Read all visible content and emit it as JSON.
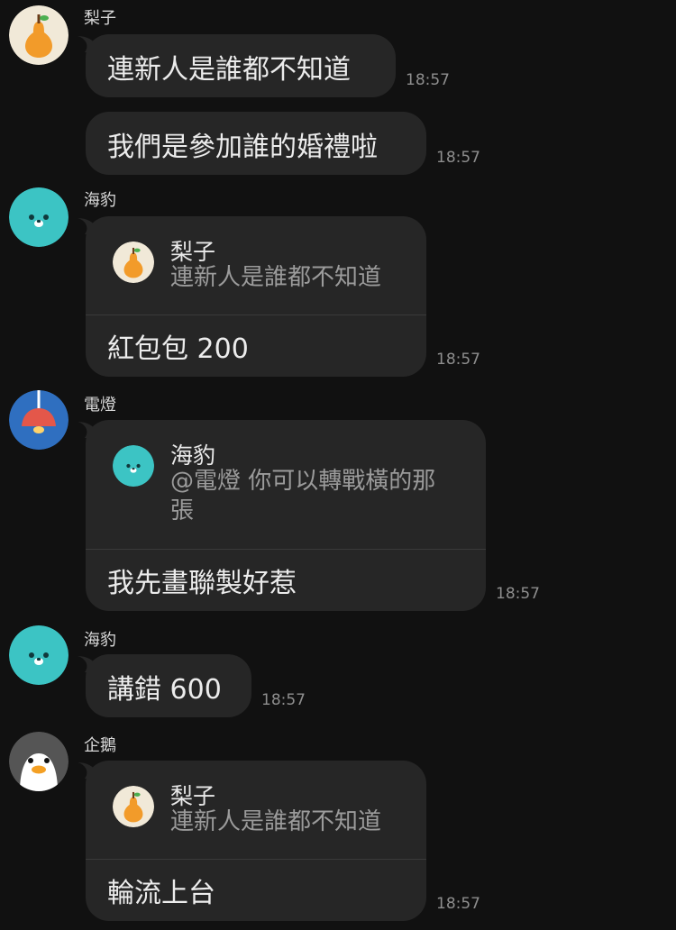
{
  "messages": [
    {
      "sender": "梨子",
      "text": "連新人是誰都不知道",
      "time": "18:57"
    },
    {
      "text": "我們是參加誰的婚禮啦",
      "time": "18:57"
    },
    {
      "sender": "海豹",
      "reply": {
        "name": "梨子",
        "text": "連新人是誰都不知道"
      },
      "text": "紅包包 200",
      "time": "18:57"
    },
    {
      "sender": "電燈",
      "reply": {
        "name": "海豹",
        "text_line1": "@電燈 你可以轉戰橫的那",
        "text_line2": "張"
      },
      "text": "我先畫聯製好惹",
      "time": "18:57"
    },
    {
      "sender": "海豹",
      "text": "講錯 600",
      "time": "18:57"
    },
    {
      "sender": "企鵝",
      "reply": {
        "name": "梨子",
        "text": "連新人是誰都不知道"
      },
      "text": "輪流上台",
      "time": "18:57"
    }
  ],
  "colors": {
    "background": "#111111",
    "bubble": "#262626",
    "seal": "#3cc4c4",
    "pear_bg": "#f1e9d8",
    "pear": "#f29b2a",
    "lamp_bg": "#2f6fc0",
    "lamp": "#e4574a",
    "penguin_bg": "#555555"
  }
}
